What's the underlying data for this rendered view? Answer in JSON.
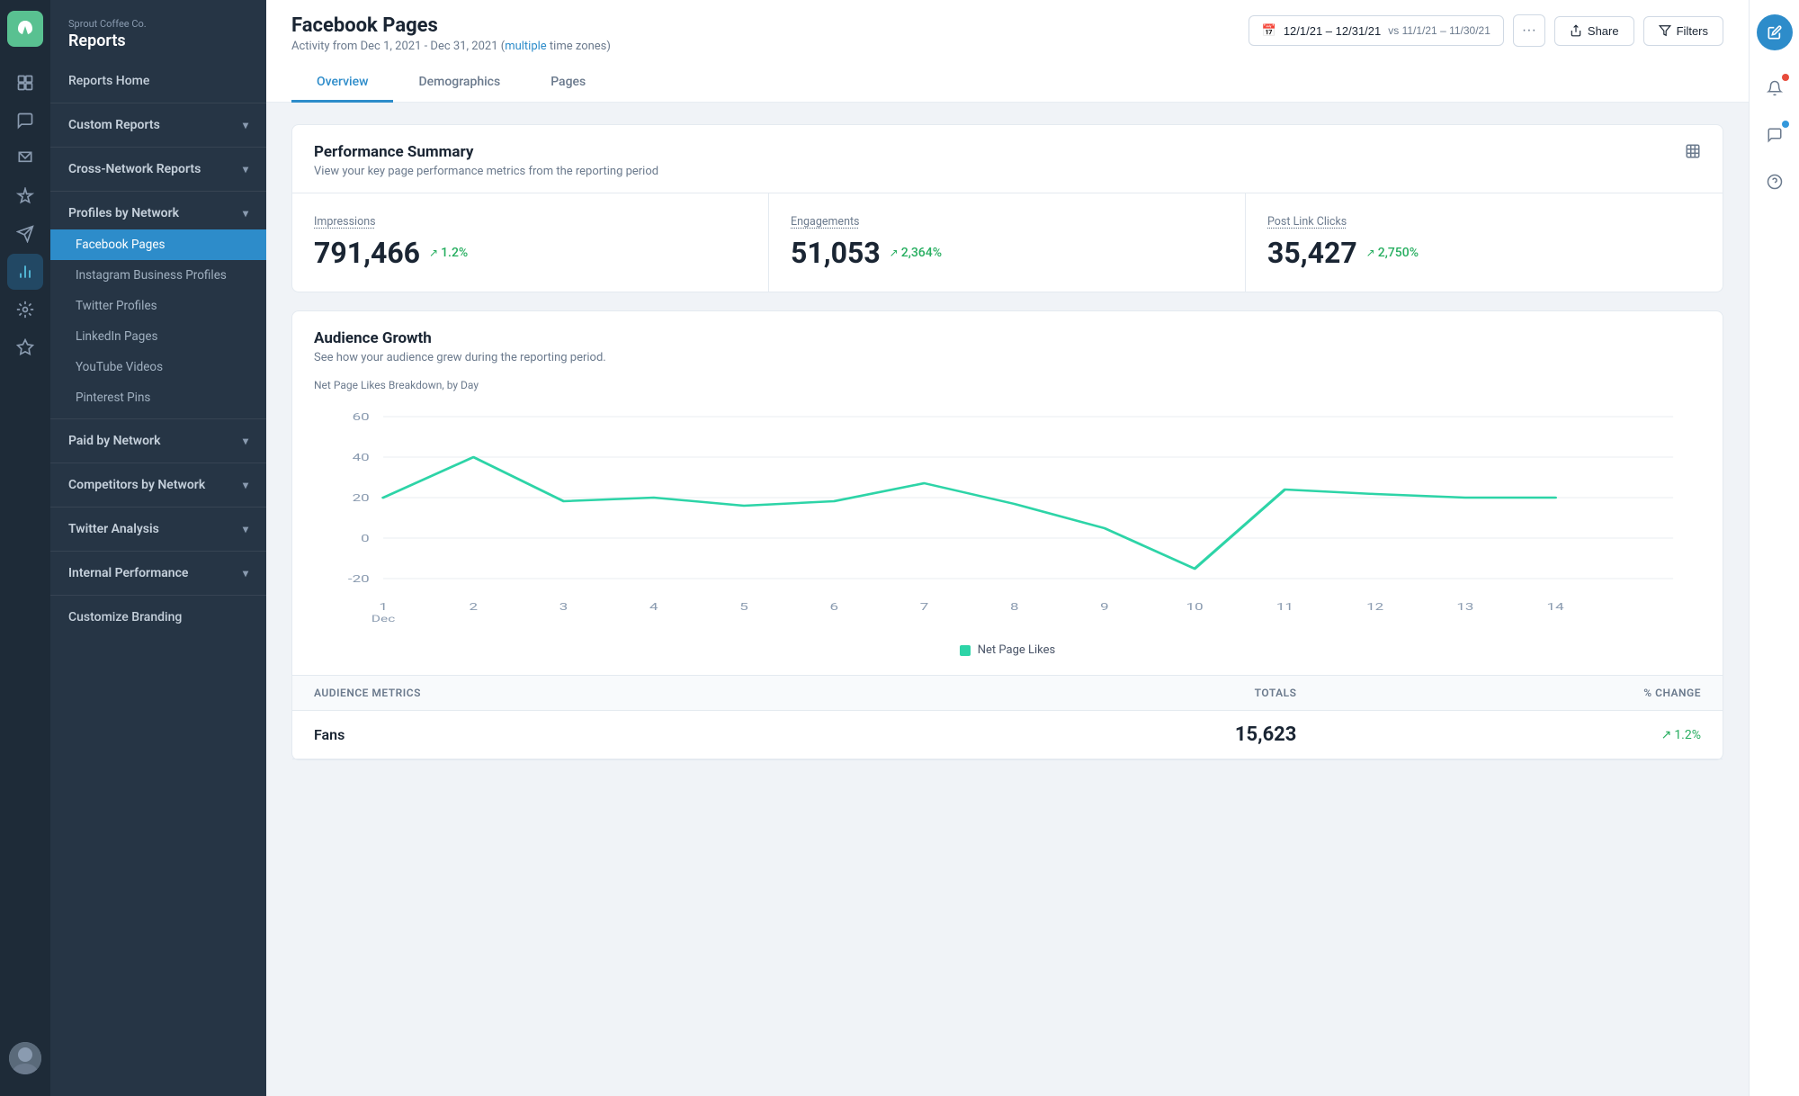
{
  "brand": {
    "company": "Sprout Coffee Co.",
    "section": "Reports"
  },
  "sidebar": {
    "items": [
      {
        "id": "reports-home",
        "label": "Reports Home",
        "type": "link",
        "active": false
      },
      {
        "id": "custom-reports",
        "label": "Custom Reports",
        "type": "section",
        "expanded": true
      },
      {
        "id": "cross-network-reports",
        "label": "Cross-Network Reports",
        "type": "section",
        "expanded": false
      },
      {
        "id": "profiles-by-network",
        "label": "Profiles by Network",
        "type": "section",
        "expanded": true
      },
      {
        "id": "facebook-pages",
        "label": "Facebook Pages",
        "type": "sub",
        "active": true
      },
      {
        "id": "instagram-business",
        "label": "Instagram Business Profiles",
        "type": "sub"
      },
      {
        "id": "twitter-profiles",
        "label": "Twitter Profiles",
        "type": "sub"
      },
      {
        "id": "linkedin-pages",
        "label": "LinkedIn Pages",
        "type": "sub"
      },
      {
        "id": "youtube-videos",
        "label": "YouTube Videos",
        "type": "sub"
      },
      {
        "id": "pinterest-pins",
        "label": "Pinterest Pins",
        "type": "sub"
      },
      {
        "id": "paid-by-network",
        "label": "Paid by Network",
        "type": "section",
        "expanded": false
      },
      {
        "id": "competitors-by-network",
        "label": "Competitors by Network",
        "type": "section",
        "expanded": false
      },
      {
        "id": "twitter-analysis",
        "label": "Twitter Analysis",
        "type": "section",
        "expanded": false
      },
      {
        "id": "internal-performance",
        "label": "Internal Performance",
        "type": "section",
        "expanded": false
      },
      {
        "id": "customize-branding",
        "label": "Customize Branding",
        "type": "link"
      }
    ]
  },
  "header": {
    "page_title": "Facebook Pages",
    "subtitle_prefix": "Activity from Dec 1, 2021 - Dec 31, 2021 (",
    "subtitle_link": "multiple",
    "subtitle_suffix": " time zones)",
    "date_range": "12/1/21 – 12/31/21",
    "vs_date": "vs 11/1/21 – 11/30/21",
    "more_label": "···",
    "share_label": "Share",
    "filters_label": "Filters"
  },
  "tabs": [
    {
      "id": "overview",
      "label": "Overview",
      "active": true
    },
    {
      "id": "demographics",
      "label": "Demographics",
      "active": false
    },
    {
      "id": "pages",
      "label": "Pages",
      "active": false
    }
  ],
  "performance_summary": {
    "title": "Performance Summary",
    "subtitle": "View your key page performance metrics from the reporting period",
    "metrics": [
      {
        "label": "Impressions",
        "value": "791,466",
        "change": "1.2%",
        "positive": true
      },
      {
        "label": "Engagements",
        "value": "51,053",
        "change": "2,364%",
        "positive": true
      },
      {
        "label": "Post Link Clicks",
        "value": "35,427",
        "change": "2,750%",
        "positive": true
      }
    ]
  },
  "audience_growth": {
    "title": "Audience Growth",
    "subtitle": "See how your audience grew during the reporting period.",
    "chart_label": "Net Page Likes Breakdown, by Day",
    "legend": "Net Page Likes",
    "y_axis": [
      60,
      40,
      20,
      0,
      -20
    ],
    "x_axis": [
      "1\nDec",
      "2",
      "3",
      "4",
      "5",
      "6",
      "7",
      "8",
      "9",
      "10",
      "11",
      "12",
      "13",
      "14"
    ],
    "legend_color": "#2dd4a7"
  },
  "audience_table": {
    "columns": [
      "Audience Metrics",
      "Totals",
      "% Change"
    ],
    "rows": [
      {
        "metric": "Fans",
        "total": "15,623",
        "change": "1.2%",
        "positive": true
      }
    ]
  },
  "right_panel": {
    "edit_icon": "✏",
    "bell_icon": "🔔",
    "chat_icon": "💬",
    "help_icon": "?"
  }
}
